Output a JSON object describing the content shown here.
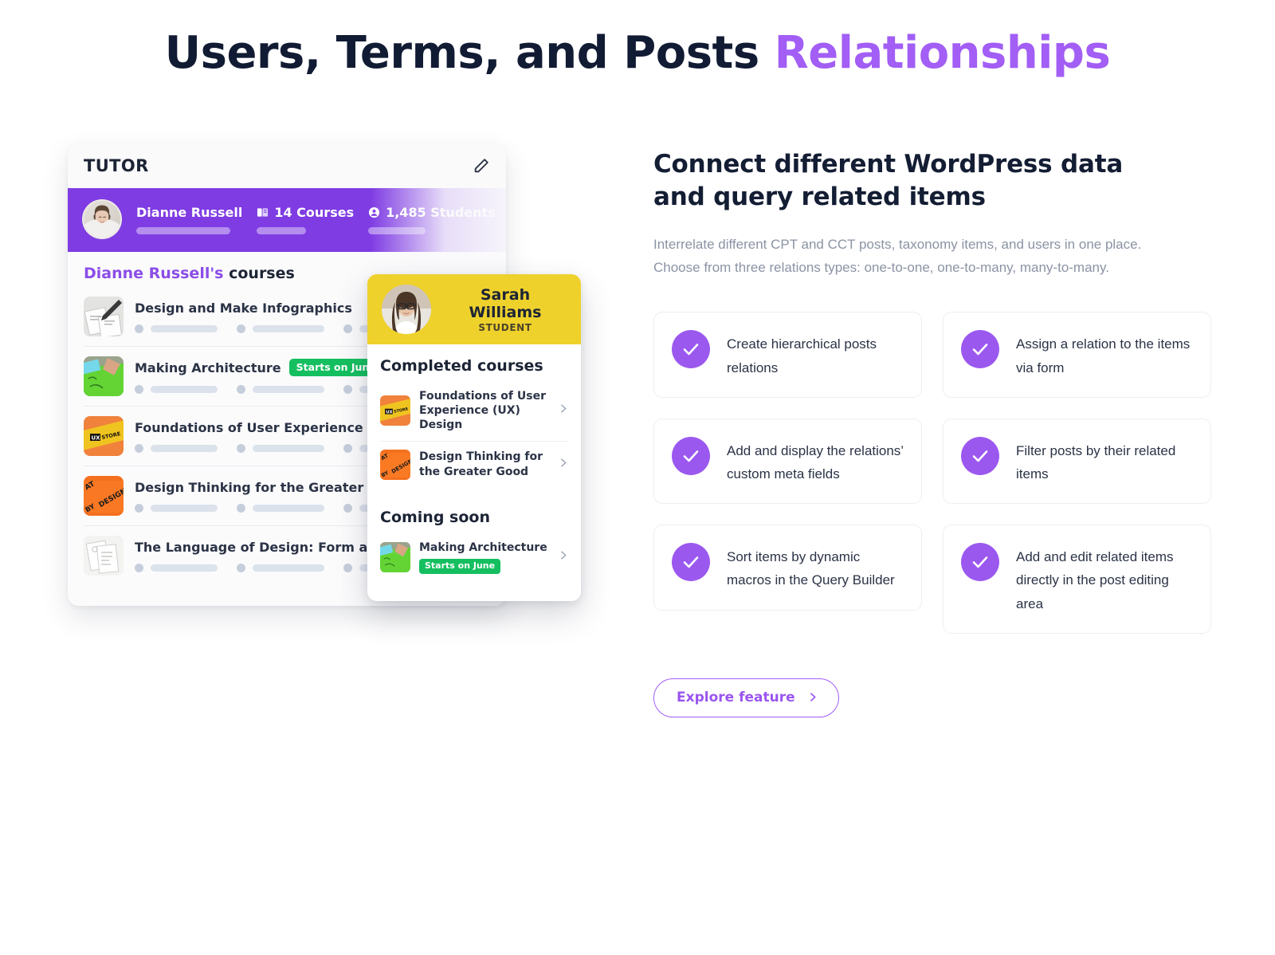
{
  "title": {
    "lead": "Users, Terms, and Posts ",
    "accent": "Relationships"
  },
  "colors": {
    "accent_purple": "#a25ef5",
    "banner_purple": "#7f3ce3",
    "check_purple": "#9b58ef",
    "student_yellow": "#efd12c",
    "badge_green": "#15bf5f",
    "heading_navy": "#131d33",
    "body_gray": "#8b93a4"
  },
  "tutor_card": {
    "header_label": "TUTOR",
    "edit_icon": "pencil-icon",
    "tutor": {
      "name": "Dianne Russell",
      "courses_icon": "book-icon",
      "courses_count": "14 Courses",
      "students_icon": "user-icon",
      "students_count": "1,485 Students"
    },
    "courses_heading_who": "Dianne Russell's",
    "courses_heading_rest": " courses",
    "courses": [
      {
        "name": "Design and Make Infographics",
        "badge": ""
      },
      {
        "name": "Making Architecture",
        "badge": "Starts on June"
      },
      {
        "name": "Foundations of User Experience (UX) Design",
        "badge": ""
      },
      {
        "name": "Design Thinking for the Greater Good",
        "badge": ""
      },
      {
        "name": "The Language of Design: Form and Meaning",
        "badge": ""
      }
    ]
  },
  "student_card": {
    "name": "Sarah Williams",
    "role": "STUDENT",
    "completed_heading": "Completed courses",
    "completed": [
      {
        "name": "Foundations of User Experience (UX) Design",
        "badge": ""
      },
      {
        "name": "Design Thinking for the Greater Good",
        "badge": ""
      }
    ],
    "coming_heading": "Coming soon",
    "coming": [
      {
        "name": "Making Architecture",
        "badge": "Starts on June"
      }
    ]
  },
  "right": {
    "heading_line1": "Connect different WordPress data",
    "heading_line2": "and query related items",
    "description": "Interrelate different CPT and CCT posts, taxonomy items, and users in one place. Choose from three relations types: one-to-one, one-to-many, many-to-many.",
    "features": [
      "Create hierarchical posts relations",
      "Assign a relation to the items via form",
      "Add and display the relations’ custom meta fields",
      "Filter posts by their related items",
      "Sort items by dynamic macros in the Query Builder",
      "Add and edit related items directly in the post editing area"
    ],
    "cta_label": "Explore feature",
    "cta_icon": "chevron-right-icon"
  }
}
